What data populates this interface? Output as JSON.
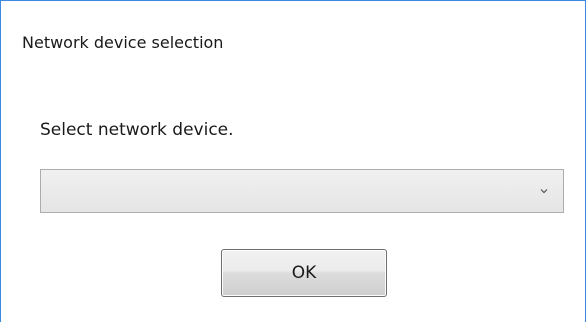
{
  "dialog": {
    "title": "Network device selection",
    "prompt": "Select network device.",
    "device_select": {
      "selected_value": "",
      "icon": "chevron-down-icon"
    },
    "ok_label": "OK"
  },
  "colors": {
    "window_border": "#3c8ae0",
    "text": "#1a1a1a",
    "control_border": "#acacac",
    "button_border": "#707070"
  }
}
